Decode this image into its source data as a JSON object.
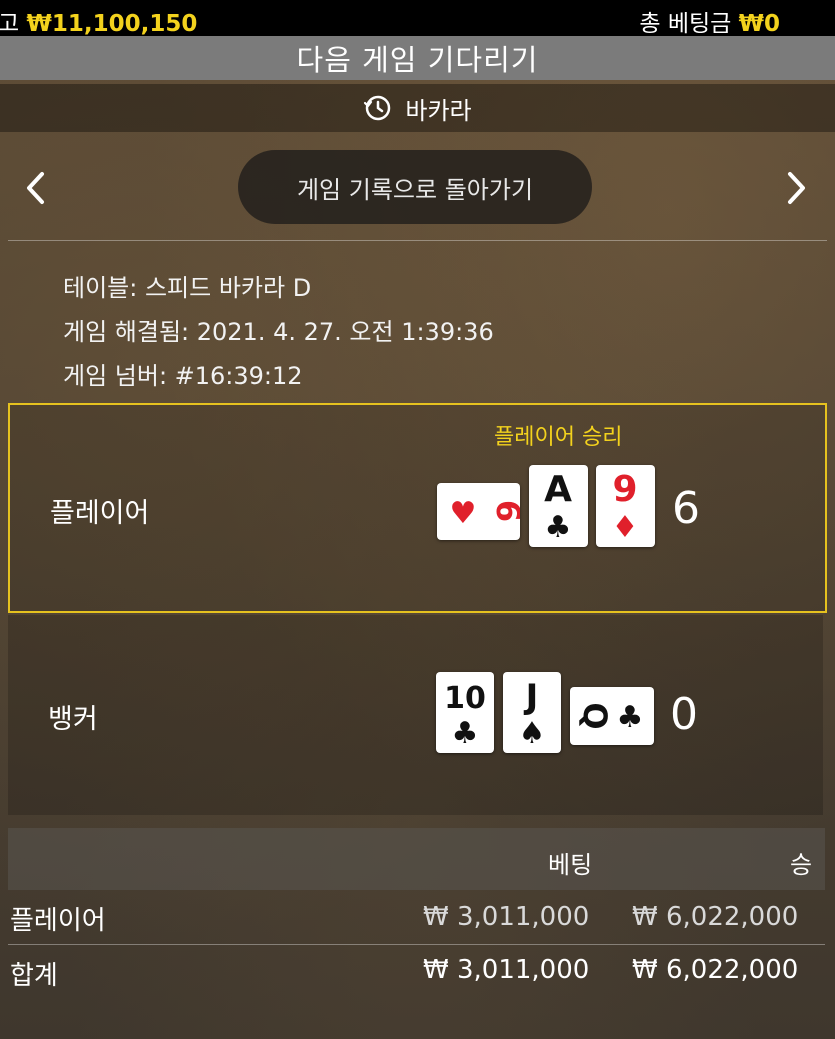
{
  "topbar": {
    "balance_prefix": "고",
    "balance_value": "₩11,100,150",
    "total_bet_label": "총 베팅금",
    "total_bet_value": "₩0"
  },
  "header": {
    "title": "다음 게임 기다리기",
    "game_name": "바카라",
    "game_name_icon": "history-icon",
    "back_button": "게임 기록으로 돌아가기"
  },
  "info": {
    "table": "테이블: 스피드 바카라 D",
    "resolved": "게임 해결됨: 2021. 4. 27. 오전 1:39:36",
    "number": "게임 넘버: #16:39:12"
  },
  "player": {
    "label": "플레이어",
    "result": "플레이어 승리",
    "score": "6",
    "cards": [
      {
        "rank": "6",
        "suit": "♥",
        "color": "#e0202b",
        "orientation": "sideways"
      },
      {
        "rank": "A",
        "suit": "♣",
        "color": "#111111",
        "orientation": "upright"
      },
      {
        "rank": "9",
        "suit": "♦",
        "color": "#e0202b",
        "orientation": "upright"
      }
    ]
  },
  "banker": {
    "label": "뱅커",
    "score": "0",
    "cards": [
      {
        "rank": "10",
        "suit": "♣",
        "color": "#111111",
        "orientation": "upright"
      },
      {
        "rank": "J",
        "suit": "♠",
        "color": "#111111",
        "orientation": "upright"
      },
      {
        "rank": "Q",
        "suit": "♣",
        "color": "#111111",
        "orientation": "sideways"
      }
    ]
  },
  "bets_table": {
    "header_bet": "베팅",
    "header_win": "승",
    "rows": [
      {
        "label": "플레이어",
        "bet": "₩ 3,011,000",
        "win": "₩ 6,022,000"
      },
      {
        "label": "합계",
        "bet": "₩ 3,011,000",
        "win": "₩ 6,022,000"
      }
    ]
  },
  "colors": {
    "accent": "#f3d21d",
    "red_suit": "#e0202b"
  }
}
